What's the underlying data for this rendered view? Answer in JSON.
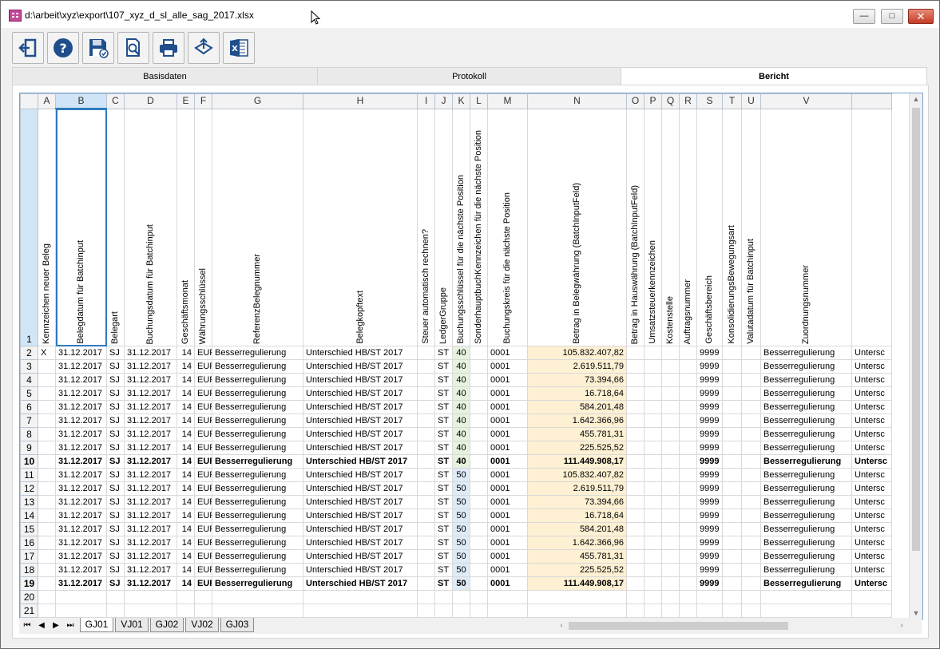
{
  "window": {
    "title": "d:\\arbeit\\xyz\\export\\107_xyz_d_sl_alle_sag_2017.xlsx",
    "min_glyph": "—",
    "max_glyph": "□",
    "close_glyph": "✕"
  },
  "toolbar": {
    "buttons": [
      {
        "icon": "exit-icon"
      },
      {
        "icon": "help-icon",
        "glyph": "?"
      },
      {
        "icon": "save-icon"
      },
      {
        "icon": "print-preview-icon"
      },
      {
        "icon": "print-icon"
      },
      {
        "icon": "export-icon"
      },
      {
        "icon": "excel-icon",
        "glyph": "X"
      }
    ]
  },
  "tabs": [
    "Basisdaten",
    "Protokoll",
    "Bericht"
  ],
  "active_tab": "Bericht",
  "grid": {
    "columns": [
      "A",
      "B",
      "C",
      "D",
      "E",
      "F",
      "G",
      "H",
      "I",
      "J",
      "K",
      "L",
      "M",
      "N",
      "O",
      "P",
      "Q",
      "R",
      "S",
      "T",
      "U",
      "V",
      ""
    ],
    "selected_column": "B",
    "header_row_number": "1",
    "headers": [
      "Kennzeichen neuer Beleg",
      "Belegdatum für Batchinput",
      "Belegart",
      "Buchungsdatum für Batchinput",
      "Geschäftsmonat",
      "Währungsschlüssel",
      "ReferenzBelegnummer",
      "Belegkopftext",
      "Steuer automatisch rechnen?",
      "LedgerGruppe",
      "Buchungsschlüssel für die nächste Position",
      "SonderhauptbuchKennzeichen für die nächste Position",
      "Buchungskreis für die nächste Position",
      "Betrag in Belegwährung (BatchInputFeld)",
      "Betrag in Hauswährung (BatchInputFeld)",
      "Umsatzsteuerkennzeichen",
      "Kostenstelle",
      "Auftragsnummer",
      "Geschäftsbereich",
      "KonsolidierungsBewegungsart",
      "Valutadatum für Batchinput",
      "Zuordnungsnummer",
      ""
    ],
    "rows": [
      {
        "n": "2",
        "bold": false,
        "A": "X",
        "B": "31.12.2017",
        "C": "SJ",
        "D": "31.12.2017",
        "E": "14",
        "F": "EUR",
        "G": "Besserregulierung",
        "H": "Unterschied HB/ST 2017",
        "J": "ST",
        "K": "40",
        "M": "0001",
        "N": "105.832.407,82",
        "S": "9999",
        "V": "Besserregulierung",
        "W": "Untersc"
      },
      {
        "n": "3",
        "bold": false,
        "A": "",
        "B": "31.12.2017",
        "C": "SJ",
        "D": "31.12.2017",
        "E": "14",
        "F": "EUR",
        "G": "Besserregulierung",
        "H": "Unterschied HB/ST 2017",
        "J": "ST",
        "K": "40",
        "M": "0001",
        "N": "2.619.511,79",
        "S": "9999",
        "V": "Besserregulierung",
        "W": "Untersc"
      },
      {
        "n": "4",
        "bold": false,
        "A": "",
        "B": "31.12.2017",
        "C": "SJ",
        "D": "31.12.2017",
        "E": "14",
        "F": "EUR",
        "G": "Besserregulierung",
        "H": "Unterschied HB/ST 2017",
        "J": "ST",
        "K": "40",
        "M": "0001",
        "N": "73.394,66",
        "S": "9999",
        "V": "Besserregulierung",
        "W": "Untersc"
      },
      {
        "n": "5",
        "bold": false,
        "A": "",
        "B": "31.12.2017",
        "C": "SJ",
        "D": "31.12.2017",
        "E": "14",
        "F": "EUR",
        "G": "Besserregulierung",
        "H": "Unterschied HB/ST 2017",
        "J": "ST",
        "K": "40",
        "M": "0001",
        "N": "16.718,64",
        "S": "9999",
        "V": "Besserregulierung",
        "W": "Untersc"
      },
      {
        "n": "6",
        "bold": false,
        "A": "",
        "B": "31.12.2017",
        "C": "SJ",
        "D": "31.12.2017",
        "E": "14",
        "F": "EUR",
        "G": "Besserregulierung",
        "H": "Unterschied HB/ST 2017",
        "J": "ST",
        "K": "40",
        "M": "0001",
        "N": "584.201,48",
        "S": "9999",
        "V": "Besserregulierung",
        "W": "Untersc"
      },
      {
        "n": "7",
        "bold": false,
        "A": "",
        "B": "31.12.2017",
        "C": "SJ",
        "D": "31.12.2017",
        "E": "14",
        "F": "EUR",
        "G": "Besserregulierung",
        "H": "Unterschied HB/ST 2017",
        "J": "ST",
        "K": "40",
        "M": "0001",
        "N": "1.642.366,96",
        "S": "9999",
        "V": "Besserregulierung",
        "W": "Untersc"
      },
      {
        "n": "8",
        "bold": false,
        "A": "",
        "B": "31.12.2017",
        "C": "SJ",
        "D": "31.12.2017",
        "E": "14",
        "F": "EUR",
        "G": "Besserregulierung",
        "H": "Unterschied HB/ST 2017",
        "J": "ST",
        "K": "40",
        "M": "0001",
        "N": "455.781,31",
        "S": "9999",
        "V": "Besserregulierung",
        "W": "Untersc"
      },
      {
        "n": "9",
        "bold": false,
        "A": "",
        "B": "31.12.2017",
        "C": "SJ",
        "D": "31.12.2017",
        "E": "14",
        "F": "EUR",
        "G": "Besserregulierung",
        "H": "Unterschied HB/ST 2017",
        "J": "ST",
        "K": "40",
        "M": "0001",
        "N": "225.525,52",
        "S": "9999",
        "V": "Besserregulierung",
        "W": "Untersc"
      },
      {
        "n": "10",
        "bold": true,
        "A": "",
        "B": "31.12.2017",
        "C": "SJ",
        "D": "31.12.2017",
        "E": "14",
        "F": "EUR",
        "G": "Besserregulierung",
        "H": "Unterschied HB/ST 2017",
        "J": "ST",
        "K": "40",
        "M": "0001",
        "N": "111.449.908,17",
        "S": "9999",
        "V": "Besserregulierung",
        "W": "Untersc"
      },
      {
        "n": "11",
        "bold": false,
        "A": "",
        "B": "31.12.2017",
        "C": "SJ",
        "D": "31.12.2017",
        "E": "14",
        "F": "EUR",
        "G": "Besserregulierung",
        "H": "Unterschied HB/ST 2017",
        "J": "ST",
        "K": "50",
        "M": "0001",
        "N": "105.832.407,82",
        "S": "9999",
        "V": "Besserregulierung",
        "W": "Untersc"
      },
      {
        "n": "12",
        "bold": false,
        "A": "",
        "B": "31.12.2017",
        "C": "SJ",
        "D": "31.12.2017",
        "E": "14",
        "F": "EUR",
        "G": "Besserregulierung",
        "H": "Unterschied HB/ST 2017",
        "J": "ST",
        "K": "50",
        "M": "0001",
        "N": "2.619.511,79",
        "S": "9999",
        "V": "Besserregulierung",
        "W": "Untersc"
      },
      {
        "n": "13",
        "bold": false,
        "A": "",
        "B": "31.12.2017",
        "C": "SJ",
        "D": "31.12.2017",
        "E": "14",
        "F": "EUR",
        "G": "Besserregulierung",
        "H": "Unterschied HB/ST 2017",
        "J": "ST",
        "K": "50",
        "M": "0001",
        "N": "73.394,66",
        "S": "9999",
        "V": "Besserregulierung",
        "W": "Untersc"
      },
      {
        "n": "14",
        "bold": false,
        "A": "",
        "B": "31.12.2017",
        "C": "SJ",
        "D": "31.12.2017",
        "E": "14",
        "F": "EUR",
        "G": "Besserregulierung",
        "H": "Unterschied HB/ST 2017",
        "J": "ST",
        "K": "50",
        "M": "0001",
        "N": "16.718,64",
        "S": "9999",
        "V": "Besserregulierung",
        "W": "Untersc"
      },
      {
        "n": "15",
        "bold": false,
        "A": "",
        "B": "31.12.2017",
        "C": "SJ",
        "D": "31.12.2017",
        "E": "14",
        "F": "EUR",
        "G": "Besserregulierung",
        "H": "Unterschied HB/ST 2017",
        "J": "ST",
        "K": "50",
        "M": "0001",
        "N": "584.201,48",
        "S": "9999",
        "V": "Besserregulierung",
        "W": "Untersc"
      },
      {
        "n": "16",
        "bold": false,
        "A": "",
        "B": "31.12.2017",
        "C": "SJ",
        "D": "31.12.2017",
        "E": "14",
        "F": "EUR",
        "G": "Besserregulierung",
        "H": "Unterschied HB/ST 2017",
        "J": "ST",
        "K": "50",
        "M": "0001",
        "N": "1.642.366,96",
        "S": "9999",
        "V": "Besserregulierung",
        "W": "Untersc"
      },
      {
        "n": "17",
        "bold": false,
        "A": "",
        "B": "31.12.2017",
        "C": "SJ",
        "D": "31.12.2017",
        "E": "14",
        "F": "EUR",
        "G": "Besserregulierung",
        "H": "Unterschied HB/ST 2017",
        "J": "ST",
        "K": "50",
        "M": "0001",
        "N": "455.781,31",
        "S": "9999",
        "V": "Besserregulierung",
        "W": "Untersc"
      },
      {
        "n": "18",
        "bold": false,
        "A": "",
        "B": "31.12.2017",
        "C": "SJ",
        "D": "31.12.2017",
        "E": "14",
        "F": "EUR",
        "G": "Besserregulierung",
        "H": "Unterschied HB/ST 2017",
        "J": "ST",
        "K": "50",
        "M": "0001",
        "N": "225.525,52",
        "S": "9999",
        "V": "Besserregulierung",
        "W": "Untersc"
      },
      {
        "n": "19",
        "bold": true,
        "A": "",
        "B": "31.12.2017",
        "C": "SJ",
        "D": "31.12.2017",
        "E": "14",
        "F": "EUR",
        "G": "Besserregulierung",
        "H": "Unterschied HB/ST 2017",
        "J": "ST",
        "K": "50",
        "M": "0001",
        "N": "111.449.908,17",
        "S": "9999",
        "V": "Besserregulierung",
        "W": "Untersc"
      },
      {
        "n": "20",
        "bold": false,
        "empty": true
      },
      {
        "n": "21",
        "bold": false,
        "empty": true
      }
    ]
  },
  "sheet_tabs": [
    "GJ01",
    "VJ01",
    "GJ02",
    "VJ02",
    "GJ03"
  ],
  "active_sheet": "GJ01",
  "colors": {
    "accent": "#2f7bbf",
    "k40_fill": "#e6f2dd",
    "k50_fill": "#deebf7",
    "amount_fill": "#fdf0d3"
  }
}
